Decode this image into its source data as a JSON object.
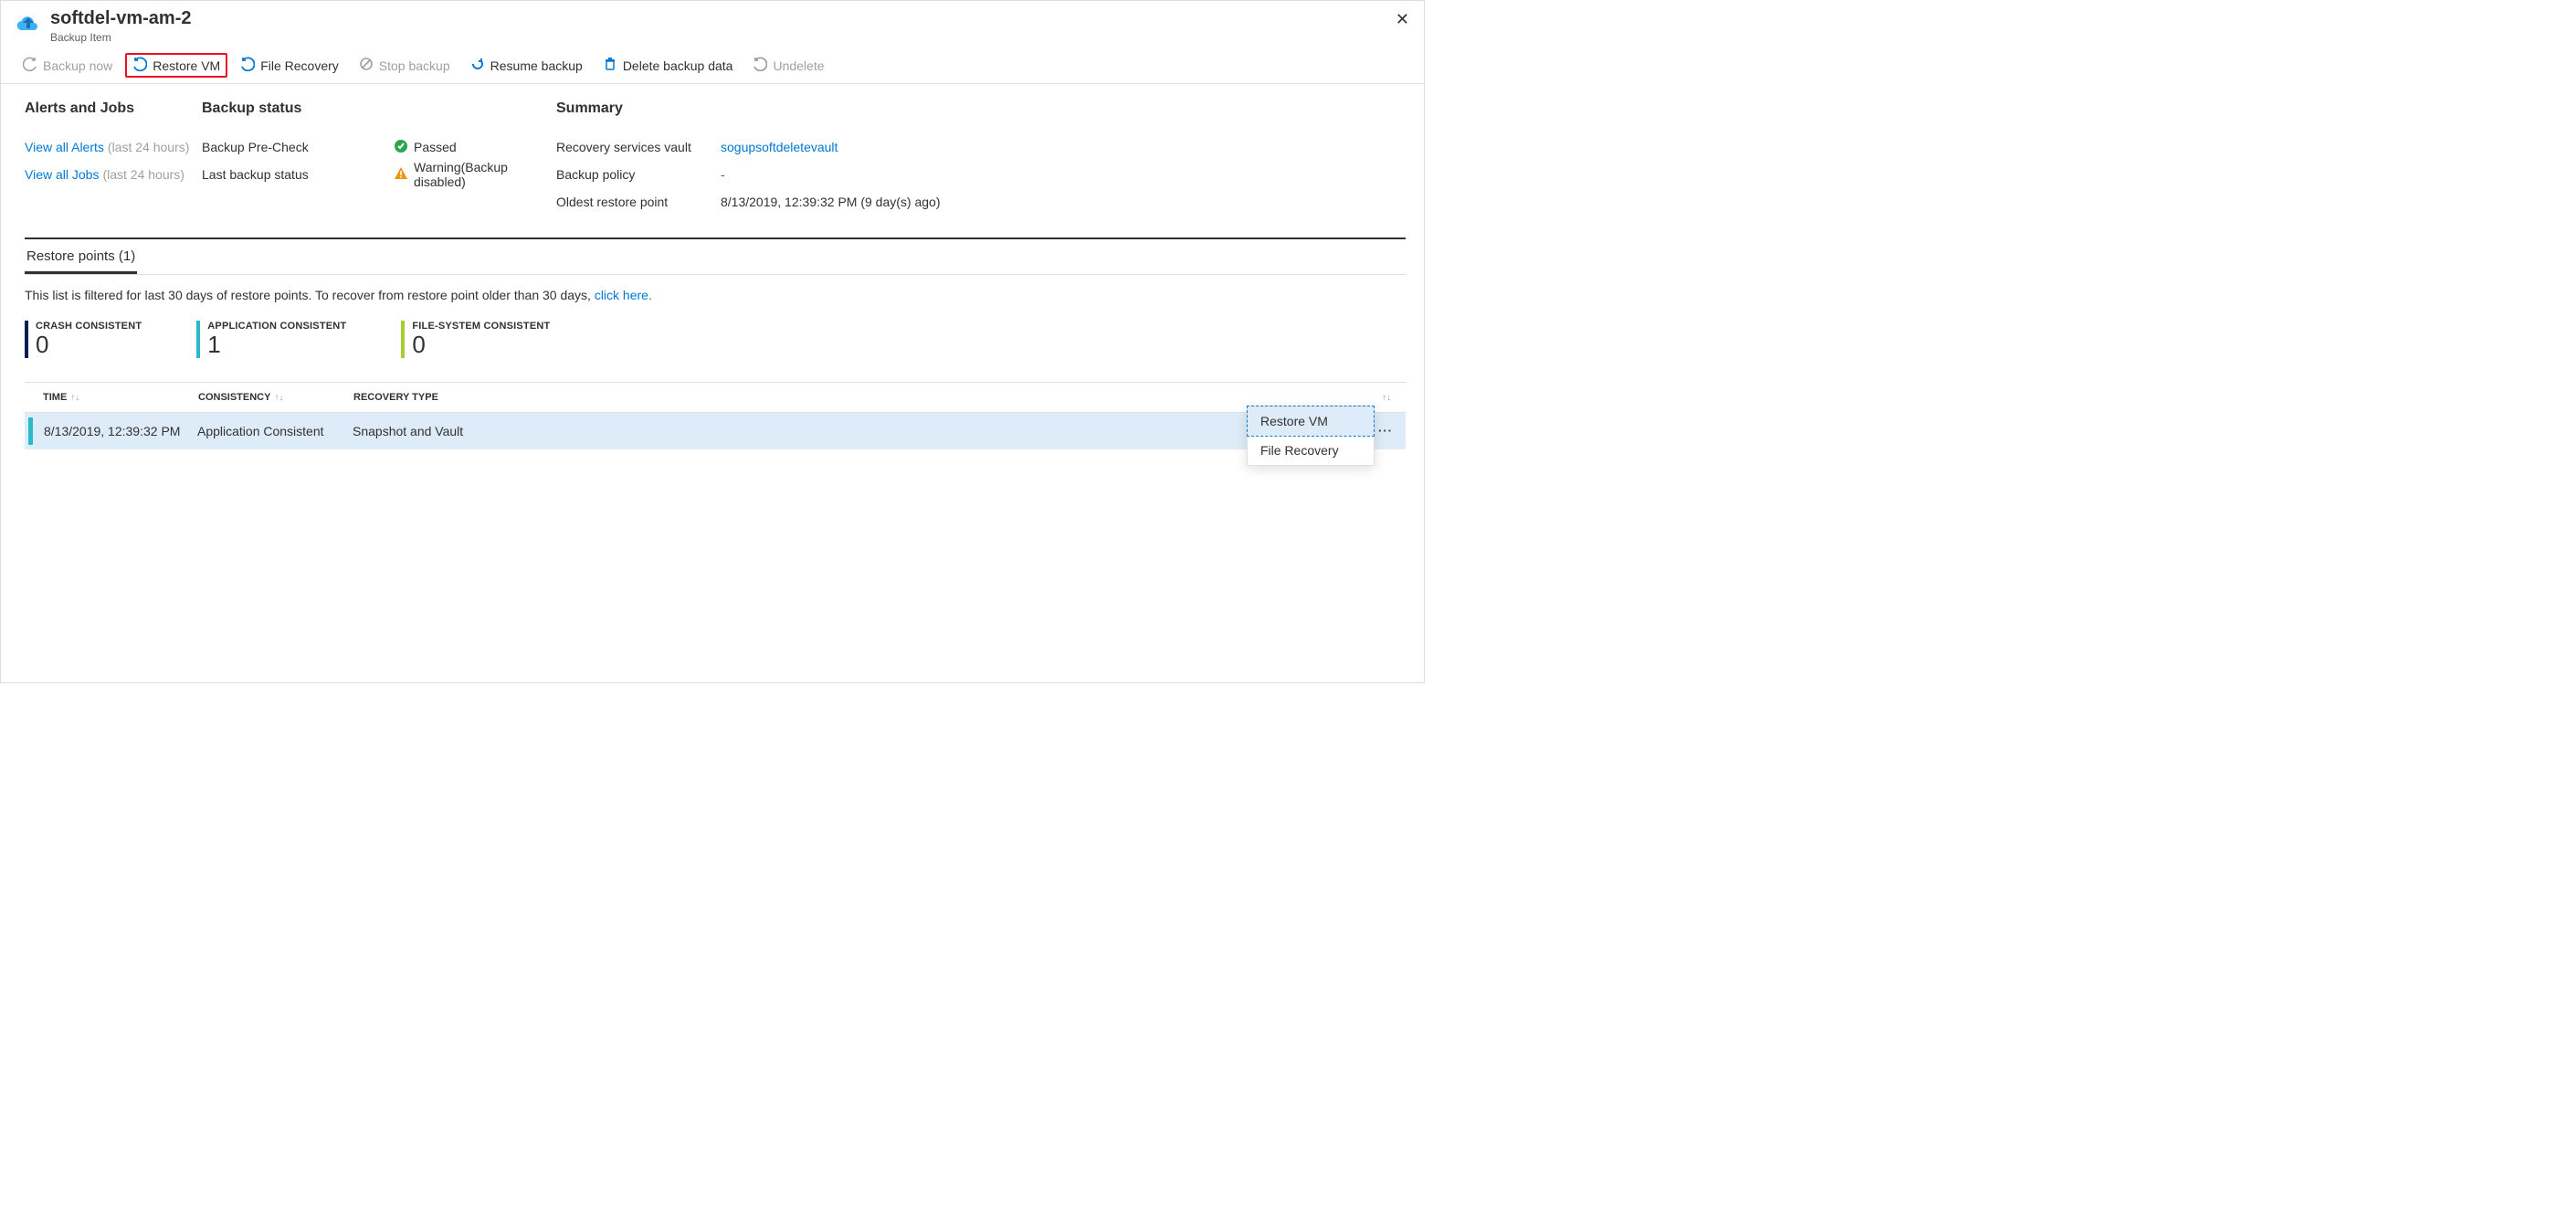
{
  "header": {
    "title": "softdel-vm-am-2",
    "subtitle": "Backup Item"
  },
  "toolbar": {
    "backup_now": "Backup now",
    "restore_vm": "Restore VM",
    "file_recovery": "File Recovery",
    "stop_backup": "Stop backup",
    "resume_backup": "Resume backup",
    "delete_backup": "Delete backup data",
    "undelete": "Undelete"
  },
  "alerts": {
    "heading": "Alerts and Jobs",
    "view_alerts": "View all Alerts",
    "view_jobs": "View all Jobs",
    "last24": "(last 24 hours)"
  },
  "status": {
    "heading": "Backup status",
    "precheck_lbl": "Backup Pre-Check",
    "precheck_val": "Passed",
    "last_lbl": "Last backup status",
    "last_val": "Warning(Backup disabled)"
  },
  "summary": {
    "heading": "Summary",
    "vault_lbl": "Recovery services vault",
    "vault_val": "sogupsoftdeletevault",
    "policy_lbl": "Backup policy",
    "policy_val": "-",
    "oldest_lbl": "Oldest restore point",
    "oldest_val": "8/13/2019, 12:39:32 PM (9 day(s) ago)"
  },
  "tabs": {
    "restore_points": "Restore points (1)"
  },
  "filter_note_pre": "This list is filtered for last 30 days of restore points. To recover from restore point older than 30 days, ",
  "filter_note_link": "click here.",
  "stats": {
    "crash": {
      "label": "CRASH CONSISTENT",
      "value": "0"
    },
    "app": {
      "label": "APPLICATION CONSISTENT",
      "value": "1"
    },
    "fs": {
      "label": "FILE-SYSTEM CONSISTENT",
      "value": "0"
    }
  },
  "table": {
    "headers": {
      "time": "TIME",
      "consistency": "CONSISTENCY",
      "recovery": "RECOVERY TYPE"
    },
    "rows": [
      {
        "time": "8/13/2019, 12:39:32 PM",
        "consistency": "Application Consistent",
        "recovery": "Snapshot and Vault"
      }
    ]
  },
  "row_menu": {
    "restore_vm": "Restore VM",
    "file_recovery": "File Recovery"
  }
}
